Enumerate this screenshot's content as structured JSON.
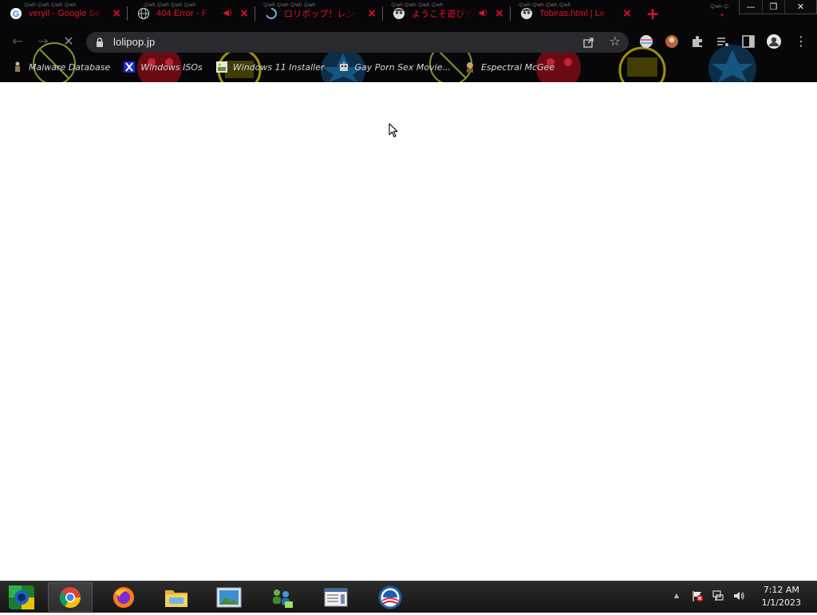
{
  "browser": {
    "tabs": [
      {
        "title": "veryil - Google Se",
        "favicon": "google-g-icon",
        "audio": false
      },
      {
        "title": "404 Error - F",
        "favicon": "globe-icon",
        "audio": true
      },
      {
        "title": "ロリポップ！レンタルサ",
        "favicon": "loading-spinner-icon",
        "audio": false
      },
      {
        "title": "ようこそ遊び方の",
        "favicon": "anime-face-icon",
        "audio": true
      },
      {
        "title": "Tobiras.html | Le",
        "favicon": "anime-face-icon",
        "audio": false
      }
    ],
    "new_tab_label": "+",
    "tab_search_label": "⌄",
    "window_controls": {
      "minimize": "—",
      "restore": "❐",
      "close": "✕"
    },
    "url": "lolipop.jp",
    "bookmarks": [
      {
        "label": "Malware Database",
        "icon": "figure-icon"
      },
      {
        "label": "Windows ISOs",
        "icon": "x-logo-icon"
      },
      {
        "label": "Windows 11 Installer",
        "icon": "image-file-icon"
      },
      {
        "label": "Gay Porn Sex Movie...",
        "icon": "robot-icon"
      },
      {
        "label": "Espectral McGee",
        "icon": "character-icon"
      }
    ]
  },
  "taskbar": {
    "apps": [
      {
        "name": "chrome",
        "active": true
      },
      {
        "name": "firefox",
        "active": false
      },
      {
        "name": "file-explorer",
        "active": false
      },
      {
        "name": "photo-viewer",
        "active": false
      },
      {
        "name": "network-people",
        "active": false
      },
      {
        "name": "notepad-window",
        "active": false
      },
      {
        "name": "obama-logo",
        "active": false
      }
    ],
    "tray": {
      "show_hidden": "▲",
      "flag": "⚑",
      "network": "🖧",
      "volume": "🔊"
    },
    "clock": {
      "time": "7:12 AM",
      "date": "1/1/2023"
    }
  },
  "colors": {
    "tab_text": "#e8102a",
    "chrome_bg": "#07070a",
    "omnibox_bg": "#2a2a2e",
    "page_bg": "#ffffff"
  }
}
